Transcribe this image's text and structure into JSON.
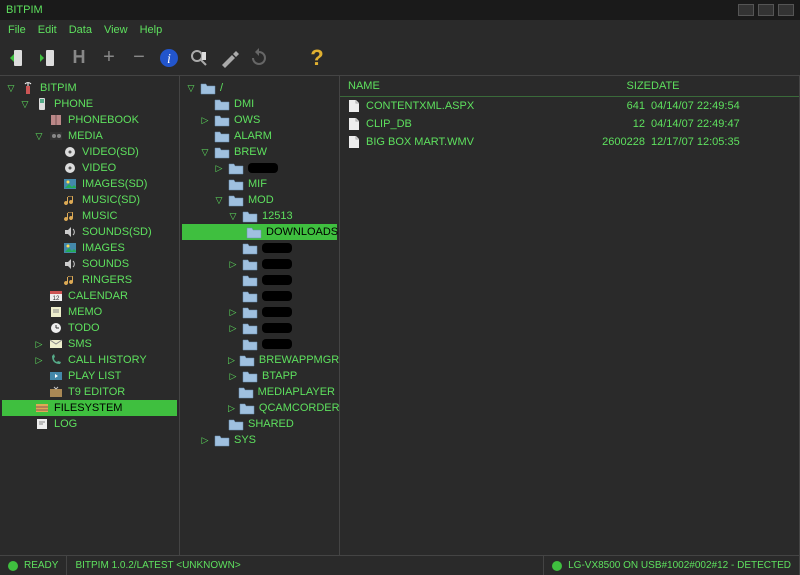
{
  "app": {
    "title": "BITPIM"
  },
  "menu": {
    "file": "File",
    "edit": "Edit",
    "data": "Data",
    "view": "View",
    "help": "Help"
  },
  "toolbar": {
    "icons": [
      "phone-send",
      "phone-get",
      "history",
      "plus",
      "minus",
      "info",
      "search",
      "tools",
      "refresh",
      "help"
    ]
  },
  "leftTree": [
    {
      "d": 0,
      "exp": "▽",
      "icon": "antenna",
      "label": "BITPIM"
    },
    {
      "d": 1,
      "exp": "▽",
      "icon": "phone",
      "label": "PHONE"
    },
    {
      "d": 2,
      "exp": " ",
      "icon": "book",
      "label": "PHONEBOOK"
    },
    {
      "d": 2,
      "exp": "▽",
      "icon": "media",
      "label": "MEDIA"
    },
    {
      "d": 3,
      "exp": " ",
      "icon": "disc",
      "label": "VIDEO(SD)"
    },
    {
      "d": 3,
      "exp": " ",
      "icon": "disc",
      "label": "VIDEO"
    },
    {
      "d": 3,
      "exp": " ",
      "icon": "img",
      "label": "IMAGES(SD)"
    },
    {
      "d": 3,
      "exp": " ",
      "icon": "music",
      "label": "MUSIC(SD)"
    },
    {
      "d": 3,
      "exp": " ",
      "icon": "music",
      "label": "MUSIC"
    },
    {
      "d": 3,
      "exp": " ",
      "icon": "sound",
      "label": "SOUNDS(SD)"
    },
    {
      "d": 3,
      "exp": " ",
      "icon": "img",
      "label": "IMAGES"
    },
    {
      "d": 3,
      "exp": " ",
      "icon": "sound",
      "label": "SOUNDS"
    },
    {
      "d": 3,
      "exp": " ",
      "icon": "music",
      "label": "RINGERS"
    },
    {
      "d": 2,
      "exp": " ",
      "icon": "cal",
      "label": "CALENDAR"
    },
    {
      "d": 2,
      "exp": " ",
      "icon": "memo",
      "label": "MEMO"
    },
    {
      "d": 2,
      "exp": " ",
      "icon": "todo",
      "label": "TODO"
    },
    {
      "d": 2,
      "exp": "▷",
      "icon": "sms",
      "label": "SMS"
    },
    {
      "d": 2,
      "exp": "▷",
      "icon": "call",
      "label": "CALL HISTORY"
    },
    {
      "d": 2,
      "exp": " ",
      "icon": "play",
      "label": "PLAY LIST"
    },
    {
      "d": 2,
      "exp": " ",
      "icon": "tv",
      "label": "T9 EDITOR"
    },
    {
      "d": 1,
      "exp": " ",
      "icon": "fs",
      "label": "FILESYSTEM",
      "selected": true
    },
    {
      "d": 1,
      "exp": " ",
      "icon": "log",
      "label": "LOG"
    }
  ],
  "midTree": [
    {
      "d": 0,
      "exp": "▽",
      "icon": "folder",
      "label": "/"
    },
    {
      "d": 1,
      "exp": " ",
      "icon": "folder",
      "label": "DMI"
    },
    {
      "d": 1,
      "exp": "▷",
      "icon": "folder",
      "label": "OWS"
    },
    {
      "d": 1,
      "exp": " ",
      "icon": "folder",
      "label": "ALARM"
    },
    {
      "d": 1,
      "exp": "▽",
      "icon": "folder",
      "label": "BREW"
    },
    {
      "d": 2,
      "exp": "▷",
      "icon": "folder",
      "redacted": true
    },
    {
      "d": 2,
      "exp": " ",
      "icon": "folder",
      "label": "MIF"
    },
    {
      "d": 2,
      "exp": "▽",
      "icon": "folder",
      "label": "MOD"
    },
    {
      "d": 3,
      "exp": "▽",
      "icon": "folder",
      "label": "12513"
    },
    {
      "d": 4,
      "exp": " ",
      "icon": "folder",
      "label": "DOWNLOADS",
      "selected": true
    },
    {
      "d": 3,
      "exp": " ",
      "icon": "folder",
      "redacted": true
    },
    {
      "d": 3,
      "exp": "▷",
      "icon": "folder",
      "redacted": true
    },
    {
      "d": 3,
      "exp": " ",
      "icon": "folder",
      "redacted": true
    },
    {
      "d": 3,
      "exp": " ",
      "icon": "folder",
      "redacted": true
    },
    {
      "d": 3,
      "exp": "▷",
      "icon": "folder",
      "redacted": true
    },
    {
      "d": 3,
      "exp": "▷",
      "icon": "folder",
      "redacted": true
    },
    {
      "d": 3,
      "exp": " ",
      "icon": "folder",
      "redacted": true
    },
    {
      "d": 3,
      "exp": "▷",
      "icon": "folder",
      "label": "BREWAPPMGR"
    },
    {
      "d": 3,
      "exp": "▷",
      "icon": "folder",
      "label": "BTAPP"
    },
    {
      "d": 3,
      "exp": " ",
      "icon": "folder",
      "label": "MEDIAPLAYER"
    },
    {
      "d": 3,
      "exp": "▷",
      "icon": "folder",
      "label": "QCAMCORDER"
    },
    {
      "d": 2,
      "exp": " ",
      "icon": "folder",
      "label": "SHARED"
    },
    {
      "d": 1,
      "exp": "▷",
      "icon": "folder",
      "label": "SYS"
    }
  ],
  "fileHdr": {
    "name": "NAME",
    "size": "SIZE",
    "date": "DATE"
  },
  "files": [
    {
      "name": "CONTENTXML.ASPX",
      "size": "641",
      "date": "04/14/07  22:49:54"
    },
    {
      "name": "CLIP_DB",
      "size": "12",
      "date": "04/14/07  22:49:47"
    },
    {
      "name": "BIG BOX MART.WMV",
      "size": "2600228",
      "date": "12/17/07  12:05:35"
    }
  ],
  "status": {
    "left": "READY",
    "mid": "BITPIM 1.0.2/LATEST <UNKNOWN>",
    "right": "LG-VX8500 ON USB#1002#002#12 - DETECTED"
  }
}
